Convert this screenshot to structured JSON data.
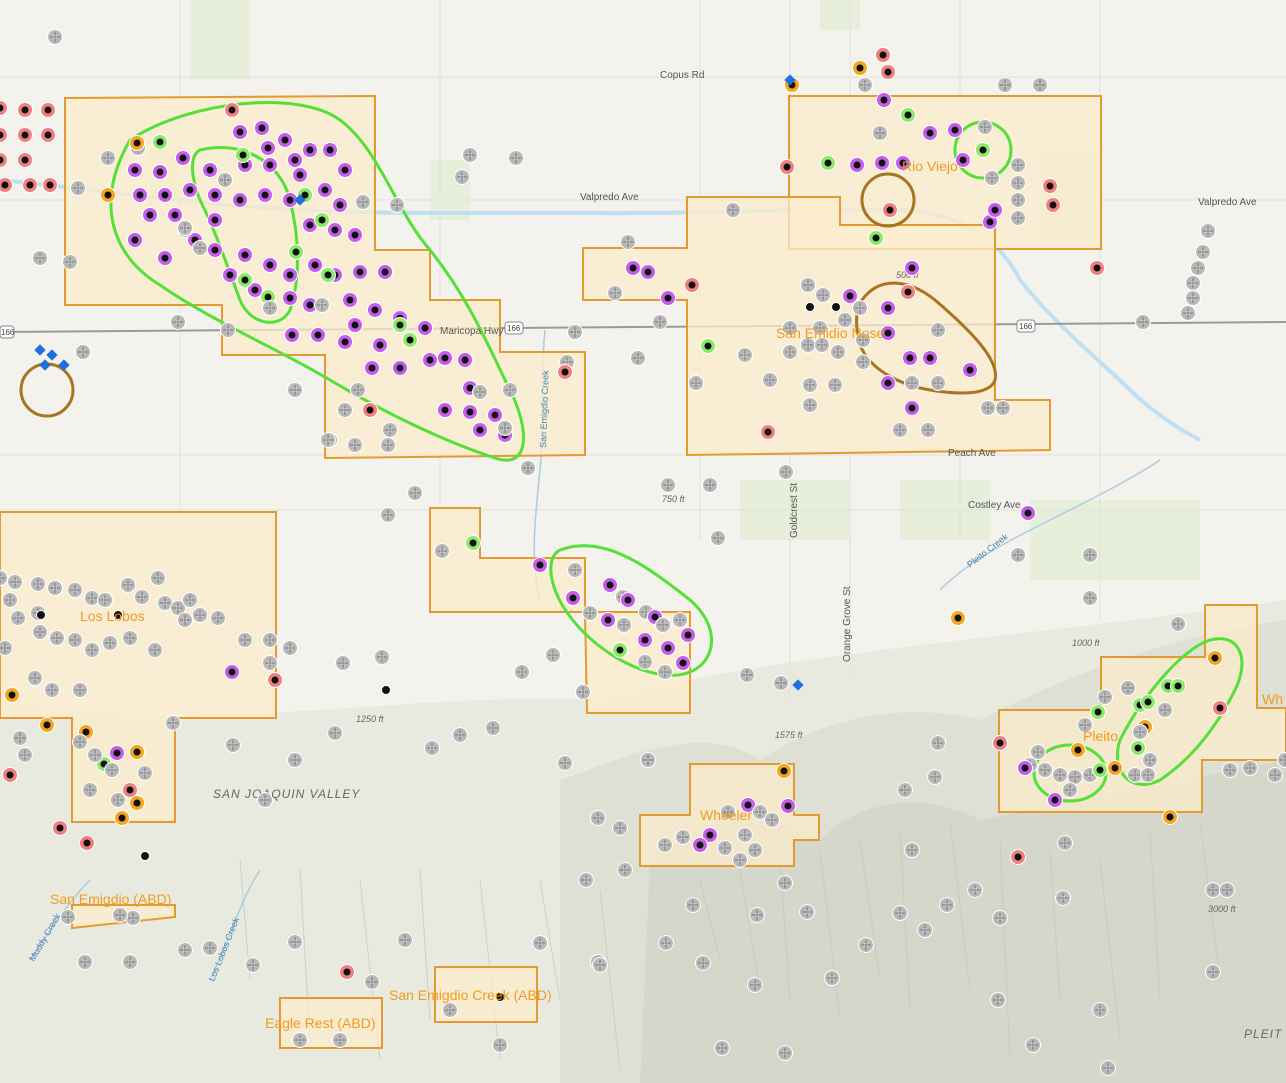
{
  "map": {
    "roads": {
      "copus": "Copus Rd",
      "valpredo_west": "Valpredo Ave",
      "valpredo_east": "Valpredo Ave",
      "maricopa": "Maricopa Hwy",
      "highway_shield": "166",
      "peach": "Peach Ave",
      "costley": "Costley Ave",
      "goldcrest": "Goldcrest St",
      "orange_grove": "Orange Grove St"
    },
    "creeks": {
      "san_emigdio": "San Emigdio Creek",
      "pleito": "Pleito Creek",
      "muddy": "Muddy Creek",
      "los_lobos": "Los Lobos Creek"
    },
    "fields": {
      "rio_viejo": "Rio Viejo",
      "san_emidio_nose": "San Emidio Nose",
      "los_lobos": "Los Lobos",
      "pleito": "Pleito",
      "wheeler": "Wheeler",
      "san_emigdio_abd": "San Emigdio (ABD)",
      "eagle_rest_abd": "Eagle Rest (ABD)",
      "san_emigdio_creek_abd": "San Emigdio Creek (ABD)",
      "whi": "Wh"
    },
    "terrain": {
      "valley": "SAN JOAQUIN VALLEY",
      "pleito": "PLEIT"
    },
    "elevations": [
      "1250 ft",
      "1575 ft",
      "1000 ft",
      "3000 ft",
      "750 ft",
      "500 ft"
    ],
    "colors": {
      "field_fill": "#fbeccb",
      "field_stroke": "#e39a30",
      "area_green": "#55e038",
      "area_brown": "#a8741f",
      "well_purple": "#c45ee6",
      "well_gray": "#b8b8b8",
      "well_green": "#8cea6a",
      "well_red": "#f08080",
      "well_orange": "#f4a623",
      "well_black": "#111111"
    }
  }
}
